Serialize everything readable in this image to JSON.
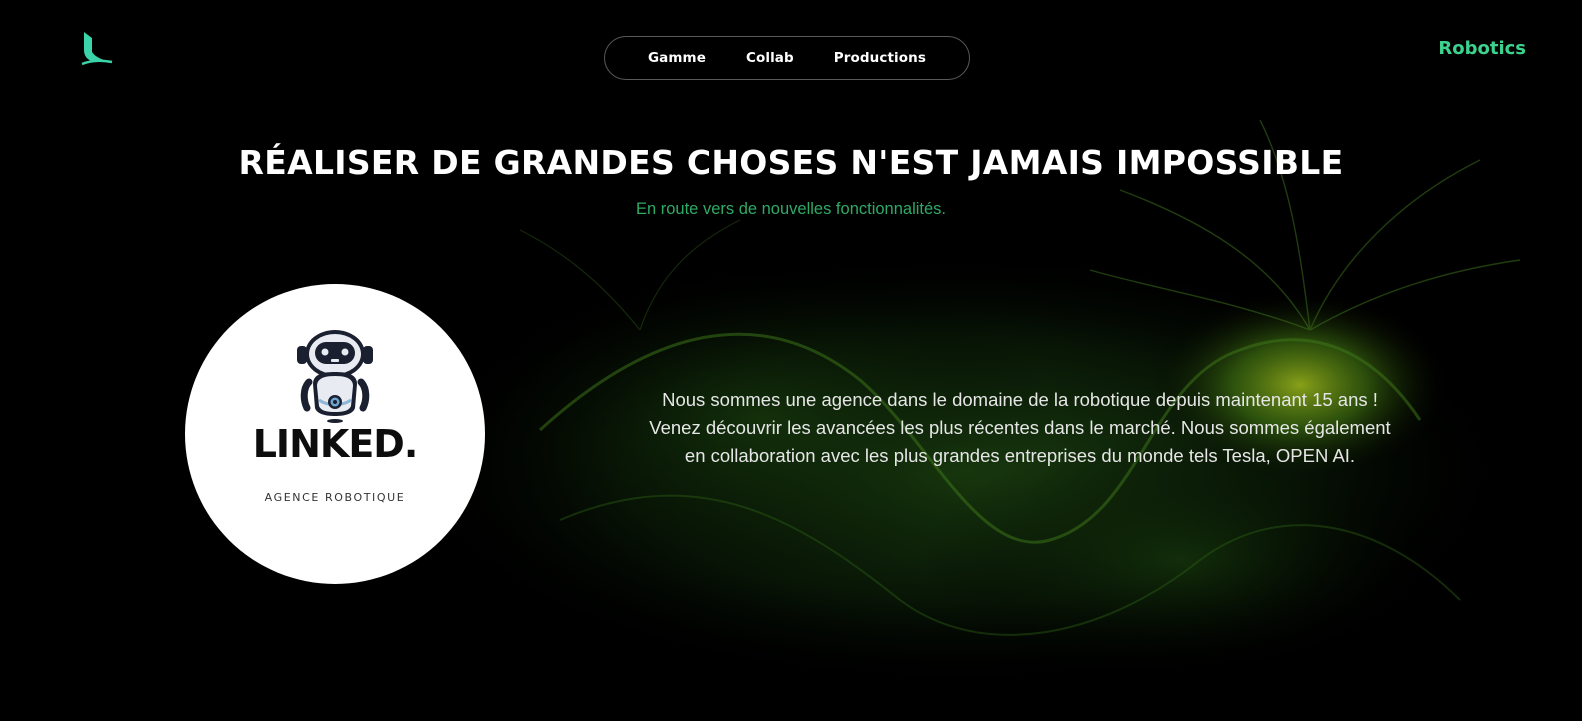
{
  "header": {
    "logo_icon": "l-logo-icon",
    "nav": [
      {
        "label": "Gamme"
      },
      {
        "label": "Collab"
      },
      {
        "label": "Productions"
      }
    ],
    "brand_link": "Robotics"
  },
  "hero": {
    "title": "RÉALISER DE GRANDES CHOSES N'EST JAMAIS IMPOSSIBLE",
    "subtitle": "En route vers de nouvelles fonctionnalités."
  },
  "company_logo": {
    "icon": "robot-icon",
    "wordmark": "LINKED.",
    "tagline": "AGENCE ROBOTIQUE"
  },
  "about": {
    "lines": [
      "Nous sommes une agence dans le domaine de la robotique depuis maintenant 15 ans !",
      "Venez découvrir les avancées les plus récentes dans le marché. Nous sommes également",
      "en collaboration avec les plus grandes entreprises du monde tels Tesla, OPEN AI."
    ]
  },
  "colors": {
    "accent": "#3bd38d",
    "subtitle": "#2faa66",
    "background": "#000000"
  }
}
